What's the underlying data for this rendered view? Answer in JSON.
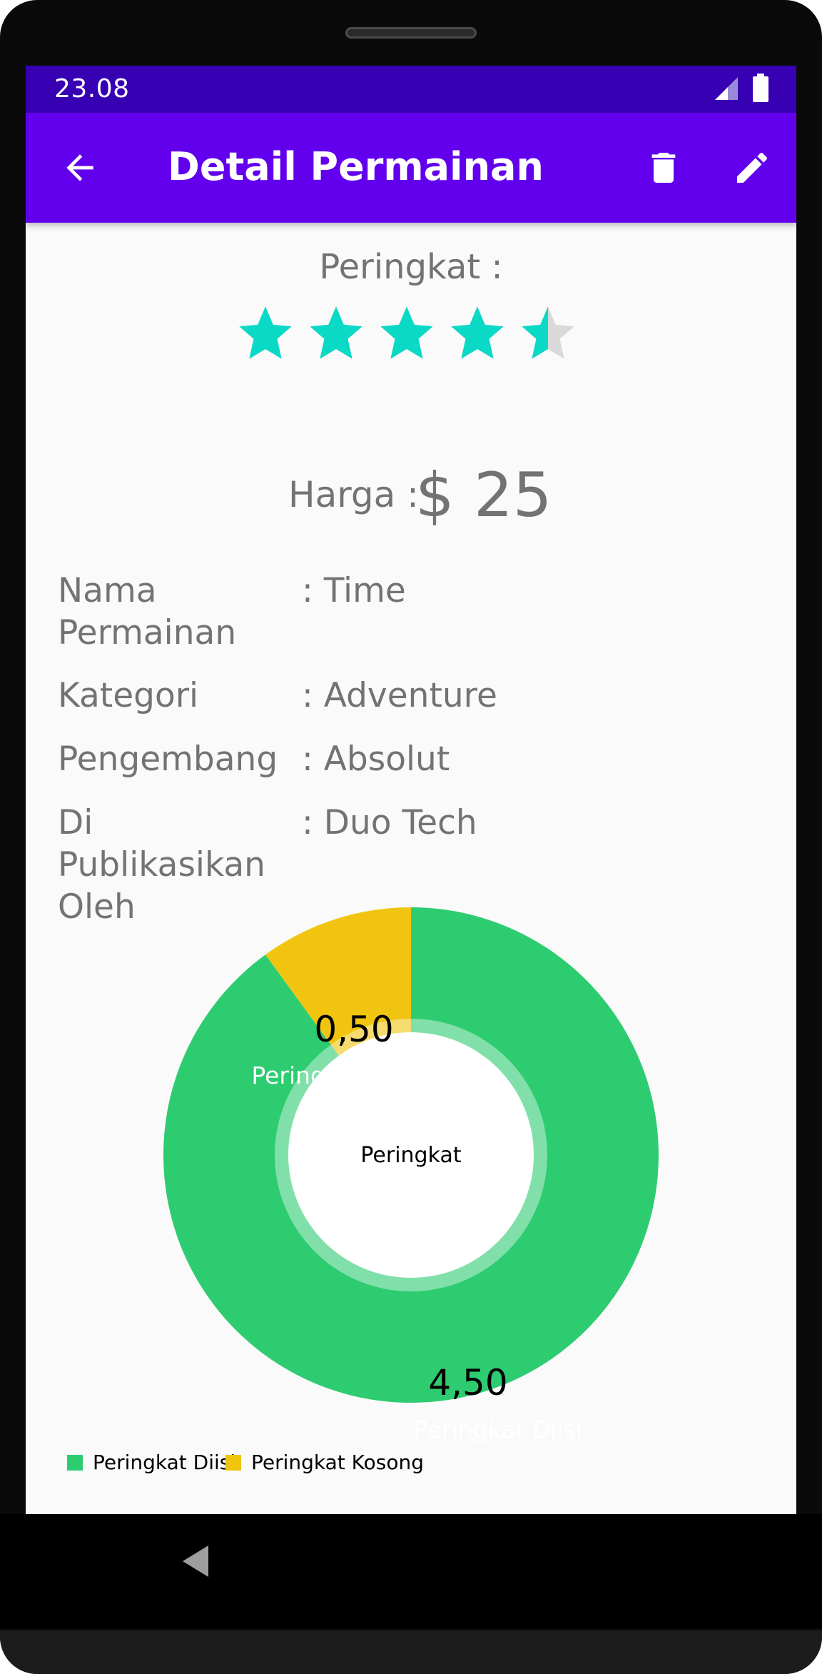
{
  "status_bar": {
    "time": "23.08"
  },
  "app_bar": {
    "title": "Detail Permainan",
    "icons": [
      "arrow-back-icon",
      "delete-icon",
      "edit-icon"
    ]
  },
  "rating": {
    "label": "Peringkat :",
    "value": 4.5,
    "max": 5
  },
  "price": {
    "label": "Harga :",
    "value": "$ 25"
  },
  "details": [
    {
      "key": "Nama\nPermainan",
      "value": ": Time"
    },
    {
      "key": "Kategori",
      "value": ": Adventure"
    },
    {
      "key": "Pengembang",
      "value": ": Absolut"
    },
    {
      "key": "Di\nPublikasikan\nOleh",
      "value": ": Duo Tech"
    }
  ],
  "colors": {
    "primary": "#6200ee",
    "primary_dark": "#3700b3",
    "star": "#0ad9c6",
    "star_empty": "#d9d9d9",
    "filled": "#2ecc71",
    "empty": "#f1c40f"
  },
  "chart_data": {
    "type": "pie",
    "center_text": "Peringkat",
    "slices": [
      {
        "label": "Peringkat Diisi",
        "value": 4.5,
        "value_label": "4,50",
        "color": "#2ecc71"
      },
      {
        "label": "Peringkat Kosong",
        "value": 0.5,
        "value_label": "0,50",
        "color": "#f1c40f"
      }
    ],
    "legend": "bottom-left"
  }
}
